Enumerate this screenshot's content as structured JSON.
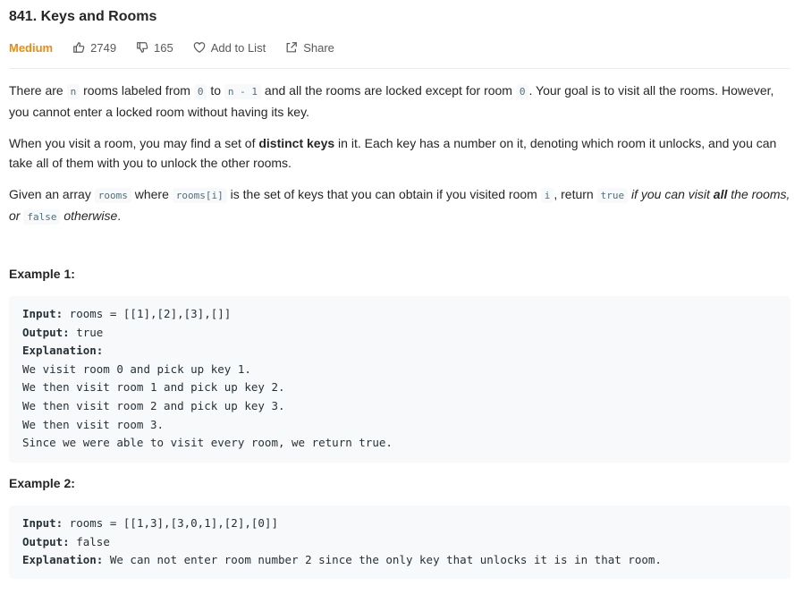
{
  "problem": {
    "title": "841. Keys and Rooms",
    "difficulty": "Medium",
    "likes": "2749",
    "dislikes": "165",
    "add_to_list": "Add to List",
    "share": "Share"
  },
  "description": {
    "p1": {
      "t1": "There are ",
      "c1": "n",
      "t2": " rooms labeled from ",
      "c2": "0",
      "t3": " to ",
      "c3": "n - 1",
      "t4": " and all the rooms are locked except for room ",
      "c4": "0",
      "t5": ". Your goal is to visit all the rooms. However, you cannot enter a locked room without having its key."
    },
    "p2": {
      "t1": "When you visit a room, you may find a set of ",
      "b1": "distinct keys",
      "t2": " in it. Each key has a number on it, denoting which room it unlocks, and you can take all of them with you to unlock the other rooms."
    },
    "p3": {
      "t1": "Given an array ",
      "c1": "rooms",
      "t2": " where ",
      "c2": "rooms[i]",
      "t3": " is the set of keys that you can obtain if you visited room ",
      "c3": "i",
      "t4": ", return ",
      "c4": "true",
      "i1": " if you can visit ",
      "ib1": "all",
      "i2": " the rooms, or ",
      "c5": "false",
      "i3": " otherwise",
      "t5": "."
    }
  },
  "examples": [
    {
      "title": "Example 1:",
      "input_label": "Input:",
      "input": " rooms = [[1],[2],[3],[]]",
      "output_label": "Output:",
      "output": " true",
      "explanation_label": "Explanation:",
      "explanation_lines": [
        "We visit room 0 and pick up key 1.",
        "We then visit room 1 and pick up key 2.",
        "We then visit room 2 and pick up key 3.",
        "We then visit room 3.",
        "Since we were able to visit every room, we return true."
      ]
    },
    {
      "title": "Example 2:",
      "input_label": "Input:",
      "input": " rooms = [[1,3],[3,0,1],[2],[0]]",
      "output_label": "Output:",
      "output": " false",
      "explanation_label": "Explanation:",
      "explanation": " We can not enter room number 2 since the only key that unlocks it is in that room."
    }
  ],
  "colors": {
    "difficulty_medium": "#ef8a0b",
    "code_bg": "#f7f9fa",
    "inline_code_text": "#546e7a"
  }
}
